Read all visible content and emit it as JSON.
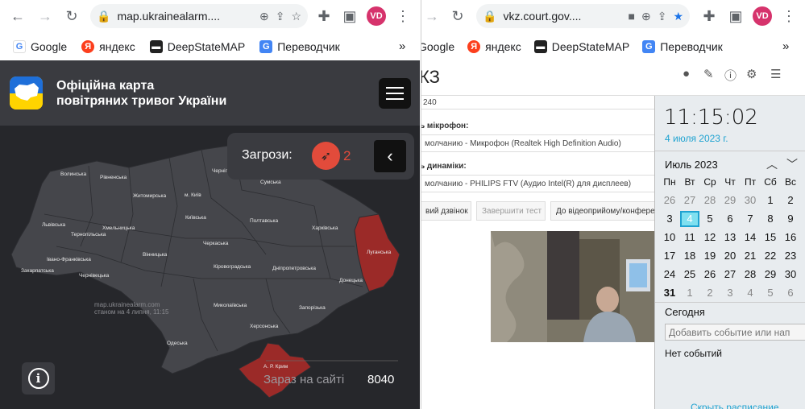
{
  "left_browser": {
    "url": "map.ukrainealarm....",
    "bookmarks": [
      {
        "label": "Google",
        "icon": "google-icon",
        "color": "#4285f4"
      },
      {
        "label": "яндекс",
        "icon": "yandex-icon",
        "color": "#fc3f1d"
      },
      {
        "label": "DeepStateMAP",
        "icon": "deepstate-icon",
        "color": "#222222"
      },
      {
        "label": "Переводчик",
        "icon": "translate-icon",
        "color": "#4285f4"
      }
    ],
    "avatar_initials": "VD",
    "more_label": "»"
  },
  "right_browser": {
    "url": "vkz.court.gov....",
    "bookmarks": [
      {
        "label": "Google",
        "icon": "google-icon",
        "color": "#4285f4"
      },
      {
        "label": "яндекс",
        "icon": "yandex-icon",
        "color": "#fc3f1d"
      },
      {
        "label": "DeepStateMAP",
        "icon": "deepstate-icon",
        "color": "#222222"
      },
      {
        "label": "Переводчик",
        "icon": "translate-icon",
        "color": "#4285f4"
      }
    ],
    "avatar_initials": "VD",
    "more_label": "»"
  },
  "alarm_app": {
    "title_line1": "Офіційна карта",
    "title_line2": "повітряних тривог України",
    "threats_label": "Загрози:",
    "threats_count": "2",
    "watermark_line1": "map.ukrainealarm.com",
    "watermark_line2": "станом на 4 липня, 11:15",
    "online_label": "Зараз на сайті",
    "online_count": "8040",
    "alert_color": "#9b2a28",
    "regions": [
      {
        "name": "Волинська",
        "alert": false
      },
      {
        "name": "Рівненська",
        "alert": false
      },
      {
        "name": "Житомирська",
        "alert": false
      },
      {
        "name": "Чернігівська",
        "alert": false
      },
      {
        "name": "Сумська",
        "alert": false
      },
      {
        "name": "м. Київ",
        "alert": false
      },
      {
        "name": "Київська",
        "alert": false
      },
      {
        "name": "Полтавська",
        "alert": false
      },
      {
        "name": "Харківська",
        "alert": false
      },
      {
        "name": "Львівська",
        "alert": false
      },
      {
        "name": "Тернопільська",
        "alert": false
      },
      {
        "name": "Хмельницька",
        "alert": false
      },
      {
        "name": "Вінницька",
        "alert": false
      },
      {
        "name": "Черкаська",
        "alert": false
      },
      {
        "name": "Луганська",
        "alert": true
      },
      {
        "name": "Івано-Франківська",
        "alert": false
      },
      {
        "name": "Закарпатська",
        "alert": false
      },
      {
        "name": "Чернівецька",
        "alert": false
      },
      {
        "name": "Кіровоградська",
        "alert": false
      },
      {
        "name": "Дніпропетровська",
        "alert": false
      },
      {
        "name": "Донецька",
        "alert": false
      },
      {
        "name": "Миколаївська",
        "alert": false
      },
      {
        "name": "Запорізька",
        "alert": false
      },
      {
        "name": "Херсонська",
        "alert": false
      },
      {
        "name": "Одеська",
        "alert": false
      },
      {
        "name": "А. Р. Крим",
        "alert": true
      }
    ]
  },
  "court_app": {
    "logo_text": "КЗ",
    "field_top": "240",
    "mic_label": "ь мікрофон:",
    "mic_value": "молчанию - Микрофон (Realtek High Definition Audio)",
    "speaker_label": "ь динаміки:",
    "speaker_value": "молчанию - PHILIPS FTV (Аудио Intel(R) для дисплеев)",
    "tabs": [
      "вий дзвінок",
      "Завершити тест",
      "До відеоприйому/конфере"
    ]
  },
  "calendar": {
    "time": "11:15:02",
    "date": "4 июля 2023 г.",
    "month_label": "Июль 2023",
    "weekdays": [
      "Пн",
      "Вт",
      "Ср",
      "Чт",
      "Пт",
      "Сб",
      "Вс"
    ],
    "rows": [
      [
        "26",
        "27",
        "28",
        "29",
        "30",
        "1",
        "2"
      ],
      [
        "3",
        "4",
        "5",
        "6",
        "7",
        "8",
        "9"
      ],
      [
        "10",
        "11",
        "12",
        "13",
        "14",
        "15",
        "16"
      ],
      [
        "17",
        "18",
        "19",
        "20",
        "21",
        "22",
        "23"
      ],
      [
        "24",
        "25",
        "26",
        "27",
        "28",
        "29",
        "30"
      ],
      [
        "31",
        "1",
        "2",
        "3",
        "4",
        "5",
        "6"
      ]
    ],
    "today_label": "Сегодня",
    "add_event_placeholder": "Добавить событие или нап",
    "no_events": "Нет событий",
    "hide_schedule": "Скрыть расписание",
    "accent_color": "#1fa3d1"
  }
}
